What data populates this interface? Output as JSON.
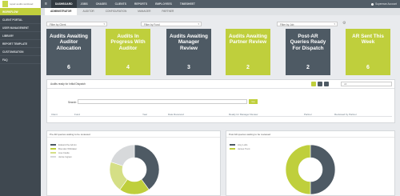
{
  "app": {
    "logo_text": "repair audits workload",
    "menu_icon": "menu-icon"
  },
  "topnav": [
    {
      "label": "DASHBOARD"
    },
    {
      "label": "JOBS"
    },
    {
      "label": "CHASES"
    },
    {
      "label": "CLIENTS"
    },
    {
      "label": "REPORTS"
    },
    {
      "label": "EMPLOYEES"
    },
    {
      "label": "TIMESHEET"
    }
  ],
  "user": {
    "name": "Superman Account"
  },
  "sidebar": [
    {
      "label": "WORKFLOW"
    },
    {
      "label": "CLIENT PORTAL"
    },
    {
      "label": "USER MANAGEMENT"
    },
    {
      "label": "LIBRARY"
    },
    {
      "label": "REPORT TEMPLATE"
    },
    {
      "label": "CUSTOMISATION"
    },
    {
      "label": "FAQ"
    }
  ],
  "subnav": [
    {
      "label": "ADMINISTRATOR"
    },
    {
      "label": "AUDITOR"
    },
    {
      "label": "CONFIGURATION"
    },
    {
      "label": "MANAGER"
    },
    {
      "label": "PARTNER"
    }
  ],
  "filters": {
    "client": {
      "label": "Filter by Client"
    },
    "fund": {
      "label": "Filter by Fund"
    },
    "job": {
      "label": "Filter by Job"
    }
  },
  "cards": [
    {
      "title": "Audits Awaiting Auditor Allocation",
      "value": "6",
      "color": "#4e5a64"
    },
    {
      "title": "Audits In Progress With Auditor",
      "value": "4",
      "color": "#bfcf3c"
    },
    {
      "title": "Audits Awaiting Manager Review",
      "value": "3",
      "color": "#4e5a64"
    },
    {
      "title": "Audits Awaiting Partner Review",
      "value": "2",
      "color": "#bfcf3c"
    },
    {
      "title": "Post-AR Queries Ready For Dispatch",
      "value": "2",
      "color": "#4e5a64"
    },
    {
      "title": "AR Sent This Week",
      "value": "6",
      "color": "#bfcf3c"
    }
  ],
  "audits_panel": {
    "title": "Audits ready for Initial Dispatch",
    "select_value": "All",
    "search_label": "Search:",
    "search_button": "Go",
    "columns": [
      "Client",
      "Fund",
      "Year",
      "Date Received",
      "Ready for Manager Review",
      "Partner",
      "Reviewed by Partner"
    ]
  },
  "chart_left": {
    "title": "Pre AR queries waiting to be reviewed",
    "legend": [
      {
        "name": "Edward the Admin",
        "color": "#4e5a64"
      },
      {
        "name": "Brendan Whittaker",
        "color": "#bfcf3c"
      },
      {
        "name": "Lisa Castle",
        "color": "#d5df86"
      },
      {
        "name": "Jamie Ingram",
        "color": "#d7d9db"
      }
    ]
  },
  "chart_right": {
    "title": "Post AR queries waiting to be reviewed",
    "legend": [
      {
        "name": "Amy Lofts",
        "color": "#4e5a64"
      },
      {
        "name": "James Trent",
        "color": "#bfcf3c"
      }
    ]
  },
  "chart_data": [
    {
      "type": "pie",
      "title": "Pre AR queries waiting to be reviewed",
      "categories": [
        "Edward the Admin",
        "Brendan Whittaker",
        "Lisa Castle",
        "Jamie Ingram"
      ],
      "values": [
        40,
        20,
        20,
        20
      ]
    },
    {
      "type": "pie",
      "title": "Post AR queries waiting to be reviewed",
      "categories": [
        "Amy Lofts",
        "James Trent"
      ],
      "values": [
        50,
        50
      ]
    }
  ]
}
